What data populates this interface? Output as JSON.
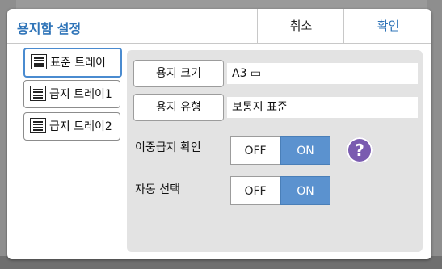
{
  "dialog": {
    "title": "용지함 설정",
    "cancel_label": "취소",
    "ok_label": "확인"
  },
  "trays": [
    {
      "label": "표준 트레이",
      "selected": true
    },
    {
      "label": "급지 트레이1",
      "selected": false
    },
    {
      "label": "급지 트레이2",
      "selected": false
    }
  ],
  "panel": {
    "paper_size": {
      "button_label": "용지 크기",
      "value": "A3 ▭"
    },
    "paper_type": {
      "button_label": "용지 유형",
      "value": "보통지 표준"
    },
    "double_feed": {
      "label": "이중급지 확인",
      "off_label": "OFF",
      "on_label": "ON",
      "selected": "ON",
      "help_label": "?"
    },
    "auto_select": {
      "label": "자동 선택",
      "off_label": "OFF",
      "on_label": "ON",
      "selected": "ON"
    }
  },
  "colors": {
    "accent": "#2f74b8",
    "toggle_on": "#5b92cf",
    "help": "#7a5bb0"
  },
  "icons": [
    "tray-icon",
    "help-icon"
  ]
}
